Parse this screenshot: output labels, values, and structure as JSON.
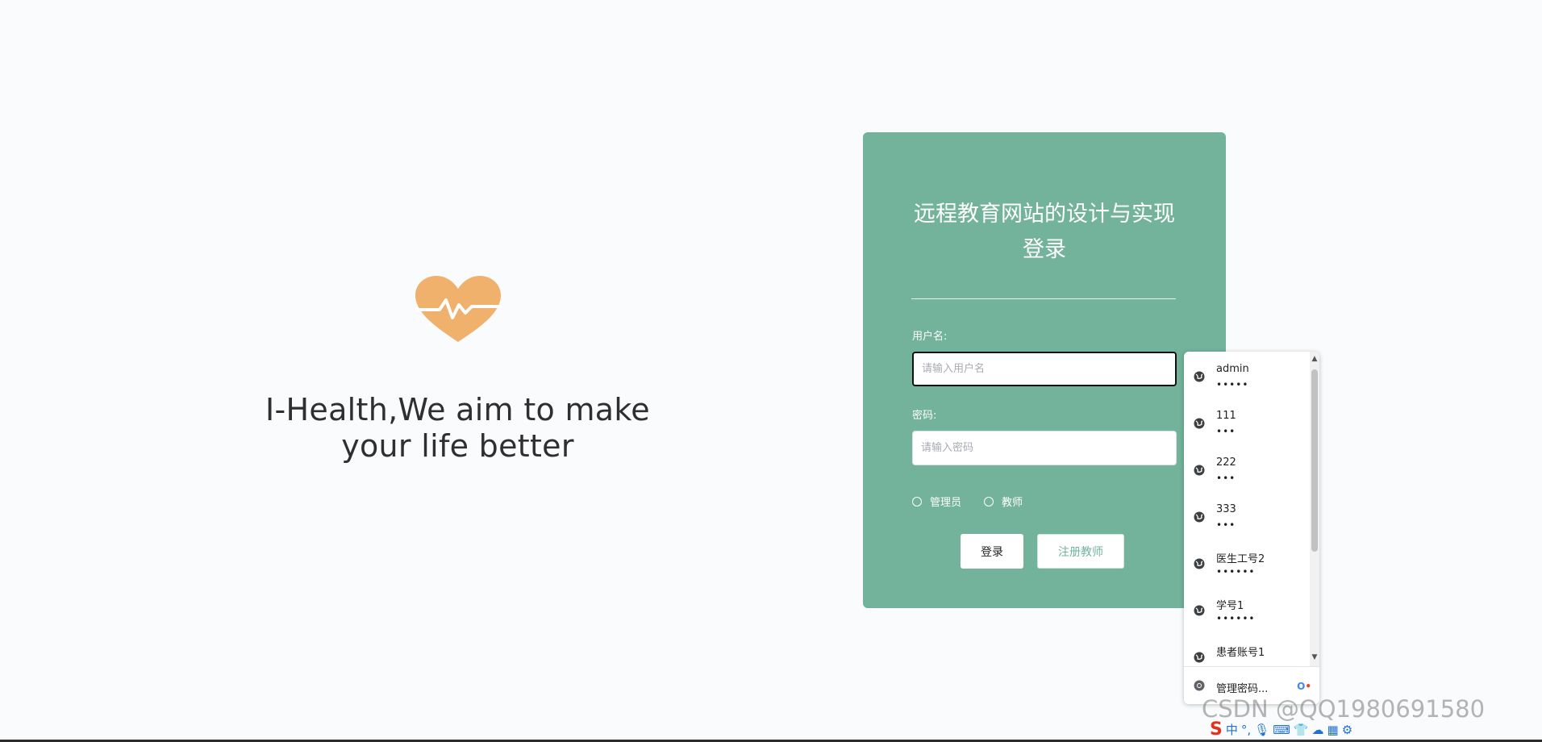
{
  "hero": {
    "slogan_line1": "I-Health,We aim to make",
    "slogan_line2": "your life better",
    "logo_color": "#f0b16d"
  },
  "login": {
    "title": "远程教育网站的设计与实现登录",
    "username_label": "用户名:",
    "username_placeholder": "请输入用户名",
    "password_label": "密码:",
    "password_placeholder": "请输入密码",
    "roles": [
      "管理员",
      "教师"
    ],
    "login_button": "登录",
    "register_button": "注册教师",
    "card_color": "#73b39b"
  },
  "autofill": {
    "entries": [
      {
        "username": "admin",
        "password_mask": "•••••"
      },
      {
        "username": "111",
        "password_mask": "•••"
      },
      {
        "username": "222",
        "password_mask": "•••"
      },
      {
        "username": "333",
        "password_mask": "•••"
      },
      {
        "username": "医生工号2",
        "password_mask": "••••••"
      },
      {
        "username": "学号1",
        "password_mask": "••••••"
      },
      {
        "username": "患者账号1",
        "password_mask": ""
      }
    ],
    "manage_label": "管理密码..."
  },
  "watermark": "CSDN @QQ1980691580",
  "tray": {
    "ime_label": "中"
  }
}
